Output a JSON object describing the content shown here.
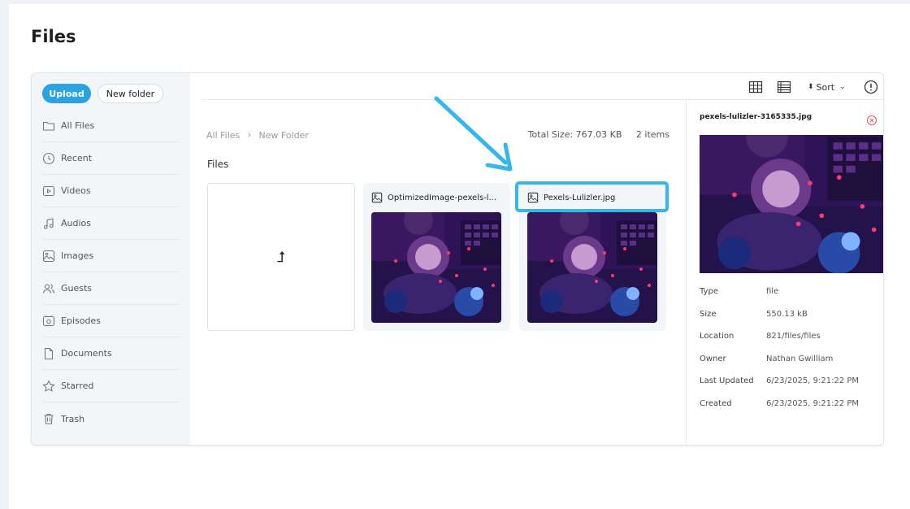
{
  "page": {
    "title": "Files"
  },
  "sidebar": {
    "upload_label": "Upload",
    "new_folder_label": "New folder",
    "items": [
      {
        "label": "All Files",
        "icon": "folder-icon"
      },
      {
        "label": "Recent",
        "icon": "clock-icon"
      },
      {
        "label": "Videos",
        "icon": "video-icon"
      },
      {
        "label": "Audios",
        "icon": "music-icon"
      },
      {
        "label": "Images",
        "icon": "image-icon"
      },
      {
        "label": "Guests",
        "icon": "users-icon"
      },
      {
        "label": "Episodes",
        "icon": "podcast-icon"
      },
      {
        "label": "Documents",
        "icon": "document-icon"
      },
      {
        "label": "Starred",
        "icon": "star-icon"
      },
      {
        "label": "Trash",
        "icon": "trash-icon"
      }
    ]
  },
  "toolbar": {
    "sort_label": "Sort",
    "icons": [
      "grid-view-icon",
      "list-view-icon",
      "sort-icon",
      "info-icon"
    ]
  },
  "main": {
    "breadcrumb": [
      "All Files",
      "New Folder"
    ],
    "total_size": "Total Size: 767.03 KB",
    "item_count": "2 items",
    "section_title": "Files",
    "up_symbol": "⮥",
    "files": [
      {
        "name": "OptimizedImage-pexels-l...",
        "icon": "image-icon"
      },
      {
        "name": "Pexels-Lulizler.jpg",
        "icon": "image-icon"
      }
    ]
  },
  "details": {
    "filename": "pexels-lulizler-3165335.jpg",
    "rows": [
      {
        "key": "Type",
        "value": "file"
      },
      {
        "key": "Size",
        "value": "550.13 kB"
      },
      {
        "key": "Location",
        "value": "821/files/files"
      },
      {
        "key": "Owner",
        "value": "Nathan Gwilliam"
      },
      {
        "key": "Last Updated",
        "value": "6/23/2025, 9:21:22 PM"
      },
      {
        "key": "Created",
        "value": "6/23/2025, 9:21:22 PM"
      }
    ]
  },
  "colors": {
    "accent": "#2aa3e2",
    "highlight": "#35b6ef",
    "close": "#e0574f"
  }
}
